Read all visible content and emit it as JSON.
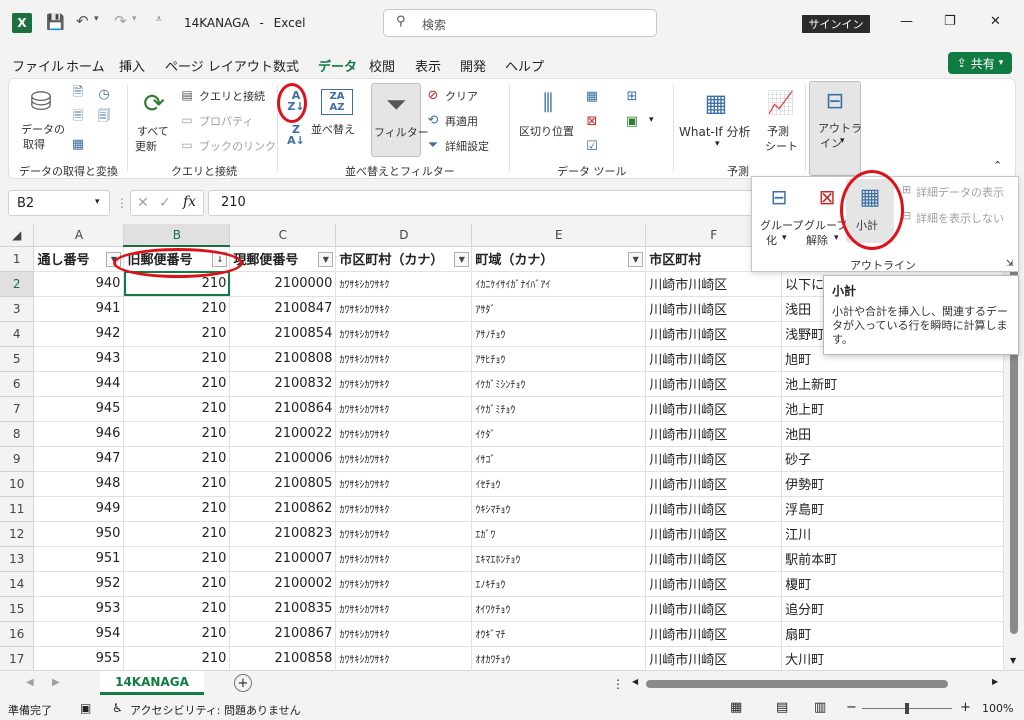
{
  "titlebar": {
    "filename": "14KANAGA",
    "app": "Excel",
    "separator": "-",
    "search_placeholder": "検索",
    "signin_label": "サインイン",
    "minimize": "—",
    "restore": "❐",
    "close": "✕"
  },
  "menu": {
    "items": [
      "ファイル",
      "ホーム",
      "挿入",
      "ページ レイアウト",
      "数式",
      "データ",
      "校閲",
      "表示",
      "開発",
      "ヘルプ"
    ],
    "active": "データ",
    "share_label": "共有"
  },
  "ribbon": {
    "get_data": {
      "label1": "データの",
      "label2": "取得",
      "group": "データの取得と変換"
    },
    "queries": {
      "refresh1": "すべて",
      "refresh2": "更新",
      "query_conn": "クエリと接続",
      "properties": "プロパティ",
      "links": "ブックのリンク",
      "group": "クエリと接続"
    },
    "sort": {
      "sort_label": "並べ替え",
      "filter_label": "フィルター",
      "clear": "クリア",
      "reapply": "再適用",
      "advanced": "詳細設定",
      "group": "並べ替えとフィルター"
    },
    "tools": {
      "text_to_columns": "区切り位置",
      "group": "データ ツール"
    },
    "forecast": {
      "whatif": "What-If 分析",
      "sheet1": "予測",
      "sheet2": "シート",
      "group": "予測"
    },
    "outline": {
      "label1": "アウトラ",
      "label2": "イン"
    }
  },
  "formula_bar": {
    "name_box": "B2",
    "formula": "210",
    "fx": "fx"
  },
  "columns": [
    "A",
    "B",
    "C",
    "D",
    "E",
    "F",
    "G"
  ],
  "header_row": [
    "通し番号",
    "旧郵便番号",
    "現郵便番号",
    "市区町村（カナ）",
    "町域（カナ）",
    "市区町村",
    ""
  ],
  "rows": [
    {
      "n": "2",
      "a": "940",
      "b": "210",
      "c": "2100000",
      "d": "ｶﾜｻｷｼｶﾜｻｷｸ",
      "e": "ｲｶﾆｹｲｻｲｶﾞﾅｲﾊﾞｱｲ",
      "f": "川崎市川崎区",
      "g": "以下に"
    },
    {
      "n": "3",
      "a": "941",
      "b": "210",
      "c": "2100847",
      "d": "ｶﾜｻｷｼｶﾜｻｷｸ",
      "e": "ｱｻﾀﾞ",
      "f": "川崎市川崎区",
      "g": "浅田"
    },
    {
      "n": "4",
      "a": "942",
      "b": "210",
      "c": "2100854",
      "d": "ｶﾜｻｷｼｶﾜｻｷｸ",
      "e": "ｱｻﾉﾁｮｳ",
      "f": "川崎市川崎区",
      "g": "浅野町"
    },
    {
      "n": "5",
      "a": "943",
      "b": "210",
      "c": "2100808",
      "d": "ｶﾜｻｷｼｶﾜｻｷｸ",
      "e": "ｱｻﾋﾁｮｳ",
      "f": "川崎市川崎区",
      "g": "旭町"
    },
    {
      "n": "6",
      "a": "944",
      "b": "210",
      "c": "2100832",
      "d": "ｶﾜｻｷｼｶﾜｻｷｸ",
      "e": "ｲｹｶﾞﾐｼﾝﾁｮｳ",
      "f": "川崎市川崎区",
      "g": "池上新町"
    },
    {
      "n": "7",
      "a": "945",
      "b": "210",
      "c": "2100864",
      "d": "ｶﾜｻｷｼｶﾜｻｷｸ",
      "e": "ｲｹｶﾞﾐﾁｮｳ",
      "f": "川崎市川崎区",
      "g": "池上町"
    },
    {
      "n": "8",
      "a": "946",
      "b": "210",
      "c": "2100022",
      "d": "ｶﾜｻｷｼｶﾜｻｷｸ",
      "e": "ｲｹﾀﾞ",
      "f": "川崎市川崎区",
      "g": "池田"
    },
    {
      "n": "9",
      "a": "947",
      "b": "210",
      "c": "2100006",
      "d": "ｶﾜｻｷｼｶﾜｻｷｸ",
      "e": "ｲｻｺﾞ",
      "f": "川崎市川崎区",
      "g": "砂子"
    },
    {
      "n": "10",
      "a": "948",
      "b": "210",
      "c": "2100805",
      "d": "ｶﾜｻｷｼｶﾜｻｷｸ",
      "e": "ｲｾﾁｮｳ",
      "f": "川崎市川崎区",
      "g": "伊勢町"
    },
    {
      "n": "11",
      "a": "949",
      "b": "210",
      "c": "2100862",
      "d": "ｶﾜｻｷｼｶﾜｻｷｸ",
      "e": "ｳｷｼﾏﾁｮｳ",
      "f": "川崎市川崎区",
      "g": "浮島町"
    },
    {
      "n": "12",
      "a": "950",
      "b": "210",
      "c": "2100823",
      "d": "ｶﾜｻｷｼｶﾜｻｷｸ",
      "e": "ｴｶﾞﾜ",
      "f": "川崎市川崎区",
      "g": "江川"
    },
    {
      "n": "13",
      "a": "951",
      "b": "210",
      "c": "2100007",
      "d": "ｶﾜｻｷｼｶﾜｻｷｸ",
      "e": "ｴｷﾏｴﾎﾝﾁｮｳ",
      "f": "川崎市川崎区",
      "g": "駅前本町"
    },
    {
      "n": "14",
      "a": "952",
      "b": "210",
      "c": "2100002",
      "d": "ｶﾜｻｷｼｶﾜｻｷｸ",
      "e": "ｴﾉｷﾁｮｳ",
      "f": "川崎市川崎区",
      "g": "榎町"
    },
    {
      "n": "15",
      "a": "953",
      "b": "210",
      "c": "2100835",
      "d": "ｶﾜｻｷｼｶﾜｻｷｸ",
      "e": "ｵｲﾜｹﾁｮｳ",
      "f": "川崎市川崎区",
      "g": "追分町"
    },
    {
      "n": "16",
      "a": "954",
      "b": "210",
      "c": "2100867",
      "d": "ｶﾜｻｷｼｶﾜｻｷｸ",
      "e": "ｵｳｷﾞﾏﾁ",
      "f": "川崎市川崎区",
      "g": "扇町"
    },
    {
      "n": "17",
      "a": "955",
      "b": "210",
      "c": "2100858",
      "d": "ｶﾜｻｷｼｶﾜｻｷｸ",
      "e": "ｵｵｶﾜﾁｮｳ",
      "f": "川崎市川崎区",
      "g": "大川町"
    }
  ],
  "outline_panel": {
    "group1": "グループ",
    "group2": "化",
    "ungroup1": "グループ",
    "ungroup2": "解除",
    "subtotal": "小計",
    "show_detail": "詳細データの表示",
    "hide_detail": "詳細を表示しない",
    "title": "アウトライン"
  },
  "tooltip": {
    "title": "小計",
    "body": "小計や合計を挿入し、関連するデータが入っている行を瞬時に計算します。"
  },
  "sheet": {
    "tab": "14KANAGA",
    "add": "+"
  },
  "status": {
    "ready": "準備完了",
    "accessibility": "アクセシビリティ: 問題ありません",
    "zoom": "100%",
    "minus": "−",
    "plus": "+"
  }
}
